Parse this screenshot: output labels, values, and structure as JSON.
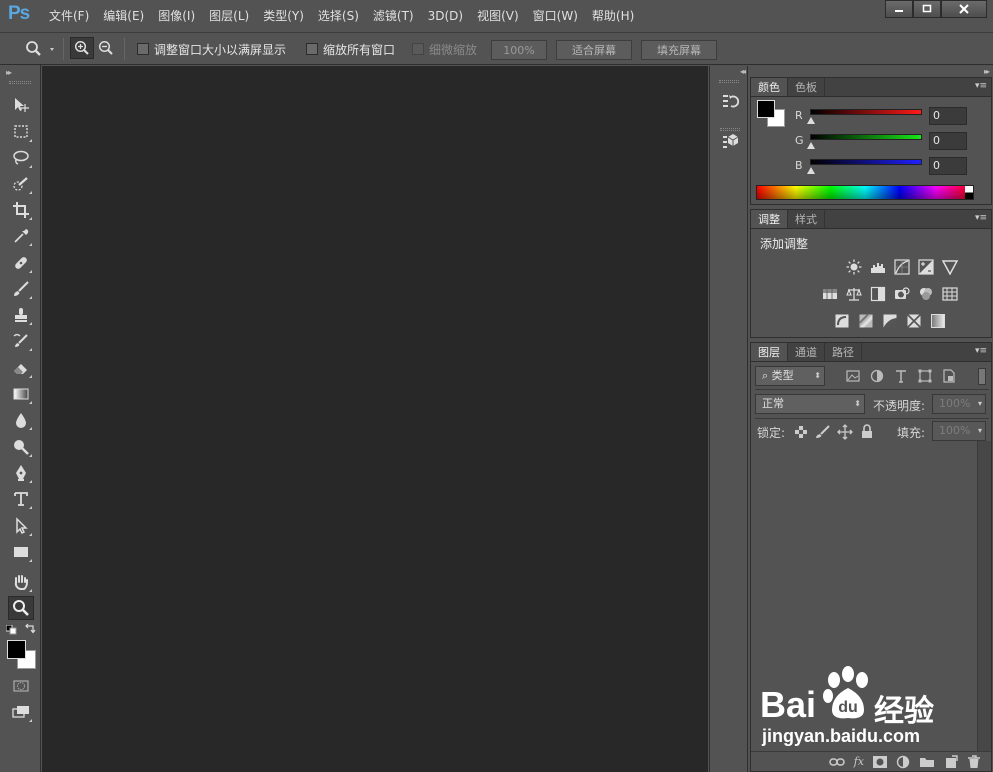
{
  "app": {
    "logo": "Ps",
    "menu": [
      "文件(F)",
      "编辑(E)",
      "图像(I)",
      "图层(L)",
      "类型(Y)",
      "选择(S)",
      "滤镜(T)",
      "3D(D)",
      "视图(V)",
      "窗口(W)",
      "帮助(H)"
    ]
  },
  "window": {
    "minimize": "▬",
    "maximize": "▢",
    "close": "✕"
  },
  "options": {
    "resize_windows": "调整窗口大小以满屏显示",
    "zoom_all": "缩放所有窗口",
    "scrubby_zoom": "细微缩放",
    "zoom_value": "100%",
    "fit_screen": "适合屏幕",
    "fill_screen": "填充屏幕"
  },
  "color_panel": {
    "tabs": [
      "颜色",
      "色板"
    ],
    "r_label": "R",
    "g_label": "G",
    "b_label": "B",
    "r": "0",
    "g": "0",
    "b": "0",
    "track_colors": {
      "r": "#ff1a1a",
      "g": "#19e619",
      "b": "#2020ff"
    }
  },
  "adjust_panel": {
    "tabs": [
      "调整",
      "样式"
    ],
    "title": "添加调整"
  },
  "layers_panel": {
    "tabs": [
      "图层",
      "通道",
      "路径"
    ],
    "filter_kind": "类型",
    "blend_mode": "正常",
    "opacity_label": "不透明度:",
    "opacity_value": "100%",
    "lock_label": "锁定:",
    "fill_label": "填充:",
    "fill_value": "100%",
    "footer_icons": [
      "link-icon",
      "fx-icon",
      "mask-icon",
      "adjust-layer-icon",
      "folder-icon",
      "new-layer-icon",
      "trash-icon"
    ],
    "fx_text": "fx"
  },
  "watermark": {
    "brand_left": "Bai",
    "brand_right": "经验",
    "url": "jingyan.baidu.com"
  },
  "colors": {
    "canvas": "#282828",
    "ui": "#535353",
    "accent": "#5aa6e0"
  }
}
